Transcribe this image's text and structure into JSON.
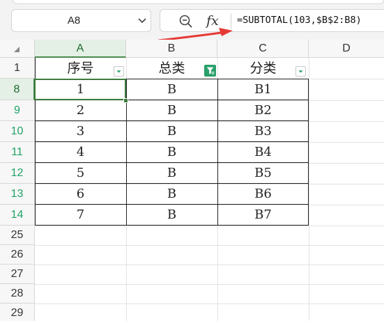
{
  "name_box": {
    "value": "A8"
  },
  "formula_bar": {
    "fx_label": "fx",
    "formula": "=SUBTOTAL(103,$B$2:B8)"
  },
  "columns": [
    "A",
    "B",
    "C",
    "D"
  ],
  "header_row": {
    "row_label": "1",
    "cells": [
      "序号",
      "总类",
      "分类"
    ]
  },
  "rows": [
    {
      "row_label": "8",
      "cells": [
        "1",
        "B",
        "B1"
      ]
    },
    {
      "row_label": "9",
      "cells": [
        "2",
        "B",
        "B2"
      ]
    },
    {
      "row_label": "10",
      "cells": [
        "3",
        "B",
        "B3"
      ]
    },
    {
      "row_label": "11",
      "cells": [
        "4",
        "B",
        "B4"
      ]
    },
    {
      "row_label": "12",
      "cells": [
        "5",
        "B",
        "B5"
      ]
    },
    {
      "row_label": "13",
      "cells": [
        "6",
        "B",
        "B6"
      ]
    },
    {
      "row_label": "14",
      "cells": [
        "7",
        "B",
        "B7"
      ]
    }
  ],
  "empty_rows": [
    "25",
    "26",
    "27",
    "28",
    "29"
  ],
  "colors": {
    "accent_green": "#3d7c3d",
    "filtered_row_number": "#21a366",
    "annotation_arrow": "#e53935"
  },
  "icons": {
    "zoom": "zoom-out-magnifier-icon",
    "filter_active": "filter-funnel-icon",
    "dropdown": "dropdown-triangle-icon",
    "select_all": "select-all-corner-icon"
  }
}
